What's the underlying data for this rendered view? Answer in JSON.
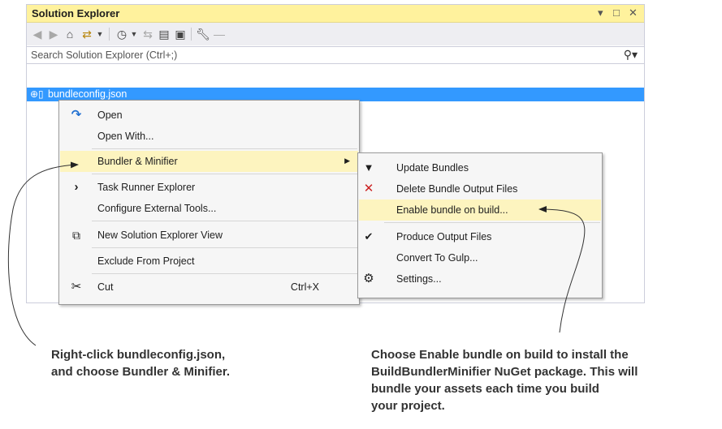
{
  "window": {
    "title": "Solution Explorer",
    "controls": {
      "dropdown": "▾",
      "maximize": "□",
      "close": "✕"
    }
  },
  "search": {
    "placeholder": "Search Solution Explorer (Ctrl+;)"
  },
  "tree": {
    "selected_item": "bundleconfig.json"
  },
  "context_menu": {
    "items": [
      {
        "label": "Open",
        "icon": "redo-arrow-icon"
      },
      {
        "label": "Open With...",
        "icon": ""
      },
      {
        "label": "Bundler & Minifier",
        "icon": "",
        "submenu": true
      },
      {
        "label": "Task Runner Explorer",
        "icon": "chevron-right-icon"
      },
      {
        "label": "Configure External Tools...",
        "icon": ""
      },
      {
        "label": "New Solution Explorer View",
        "icon": "new-view-icon"
      },
      {
        "label": "Exclude From Project",
        "icon": ""
      },
      {
        "label": "Cut",
        "icon": "scissors-icon",
        "shortcut": "Ctrl+X"
      }
    ]
  },
  "submenu": {
    "items": [
      {
        "label": "Update Bundles",
        "icon": "funnel-icon"
      },
      {
        "label": "Delete Bundle Output Files",
        "icon": "delete-x-icon"
      },
      {
        "label": "Enable bundle on build...",
        "icon": ""
      },
      {
        "label": "Produce Output Files",
        "icon": "checkmark-icon"
      },
      {
        "label": "Convert To Gulp...",
        "icon": ""
      },
      {
        "label": "Settings...",
        "icon": "gear-icon"
      }
    ]
  },
  "annotations": {
    "left": [
      "Right-click bundleconfig.json,",
      "and choose Bundler & Minifier."
    ],
    "right": [
      "Choose Enable bundle on build to install the",
      "BuildBundlerMinifier NuGet package. This will",
      "bundle your assets each time you build",
      "your project."
    ]
  },
  "colors": {
    "title_bar": "#fff29d",
    "selection": "#3399ff",
    "menu_highlight": "#fdf4bf",
    "delete_icon": "#cc2222"
  }
}
